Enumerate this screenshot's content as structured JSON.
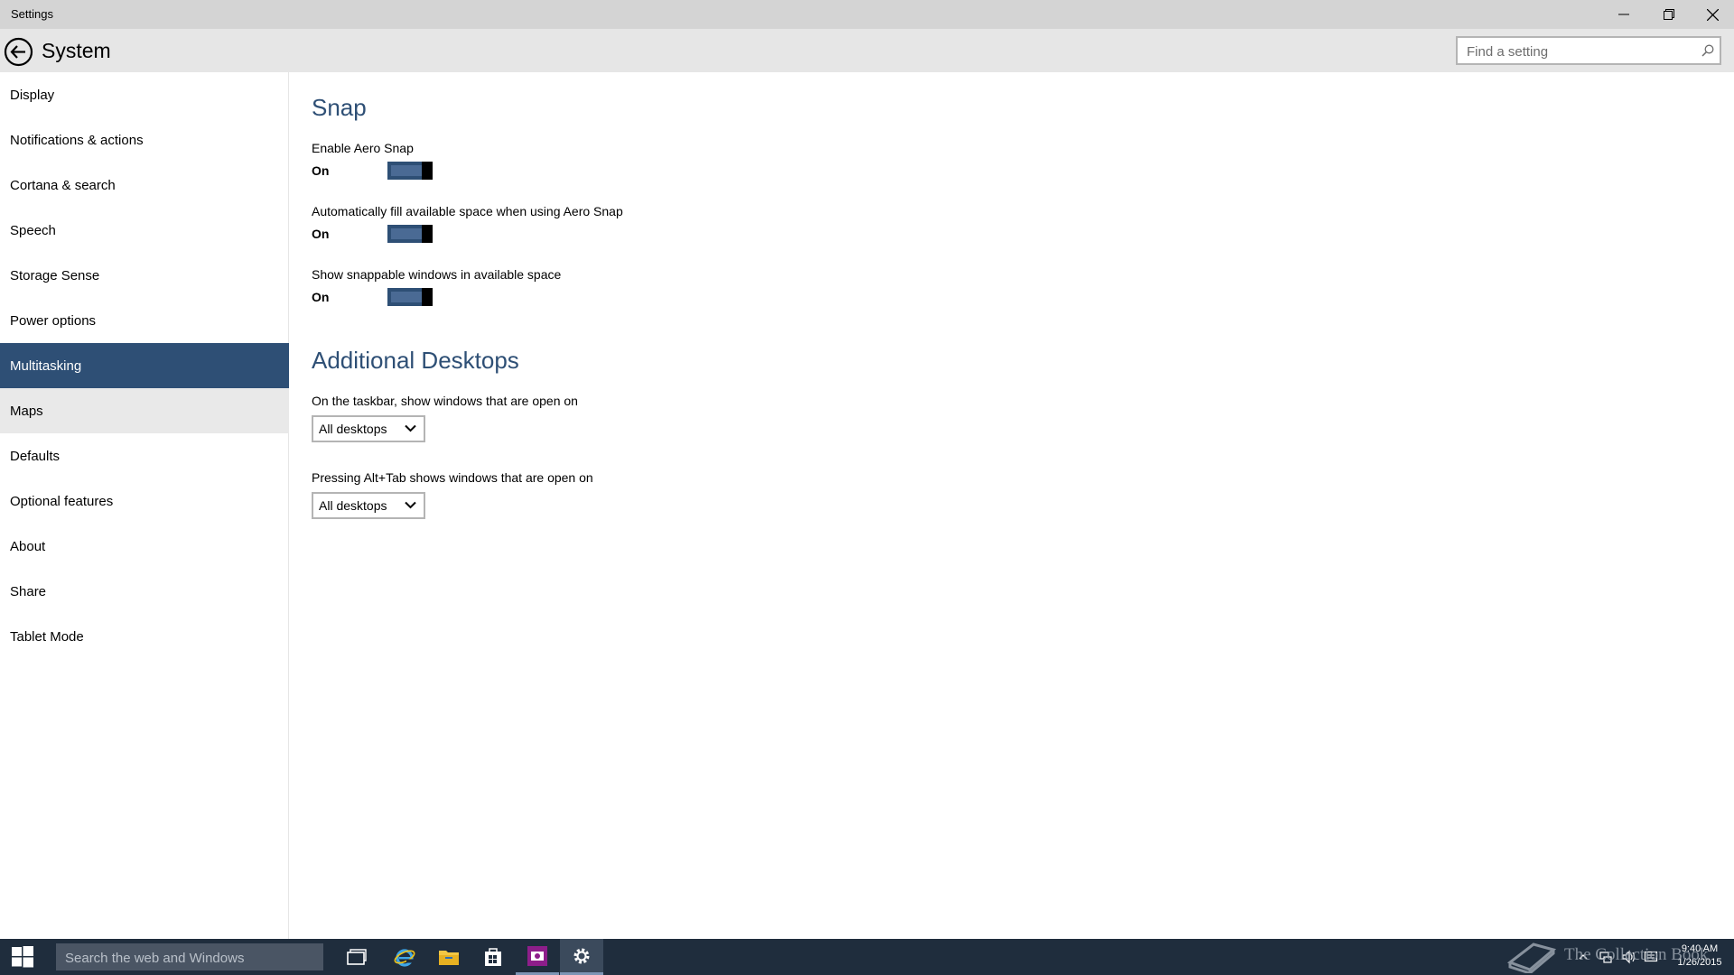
{
  "window": {
    "title": "Settings",
    "controls": [
      "minimize-icon",
      "restore-icon",
      "close-icon"
    ]
  },
  "header": {
    "page_title": "System",
    "search_placeholder": "Find a setting"
  },
  "sidebar": {
    "items": [
      {
        "label": "Display"
      },
      {
        "label": "Notifications & actions"
      },
      {
        "label": "Cortana & search"
      },
      {
        "label": "Speech"
      },
      {
        "label": "Storage Sense"
      },
      {
        "label": "Power options"
      },
      {
        "label": "Multitasking",
        "selected": true
      },
      {
        "label": "Maps",
        "hover": true
      },
      {
        "label": "Defaults"
      },
      {
        "label": "Optional features"
      },
      {
        "label": "About"
      },
      {
        "label": "Share"
      },
      {
        "label": "Tablet Mode"
      }
    ]
  },
  "snap": {
    "title": "Snap",
    "settings": [
      {
        "label": "Enable Aero Snap",
        "state": "On"
      },
      {
        "label": "Automatically fill available space when using Aero Snap",
        "state": "On"
      },
      {
        "label": "Show snappable windows in available space",
        "state": "On"
      }
    ]
  },
  "desktops": {
    "title": "Additional Desktops",
    "settings": [
      {
        "label": "On the taskbar, show windows that are open on",
        "value": "All desktops"
      },
      {
        "label": "Pressing Alt+Tab shows windows that are open on",
        "value": "All desktops"
      }
    ]
  },
  "taskbar": {
    "search_placeholder": "Search the web and Windows",
    "apps": [
      "task-view-icon",
      "internet-explorer-icon",
      "file-explorer-icon",
      "store-icon",
      "media-app-icon",
      "settings-gear-icon"
    ],
    "clock_time": "9:40 AM",
    "clock_date": "1/26/2015"
  },
  "watermark": {
    "text": "The Collection Book"
  },
  "colors": {
    "accent": "#2e4f75",
    "titlebar": "#d4d4d4",
    "header": "#e6e6e6",
    "taskbar": "#1f2d3d"
  }
}
